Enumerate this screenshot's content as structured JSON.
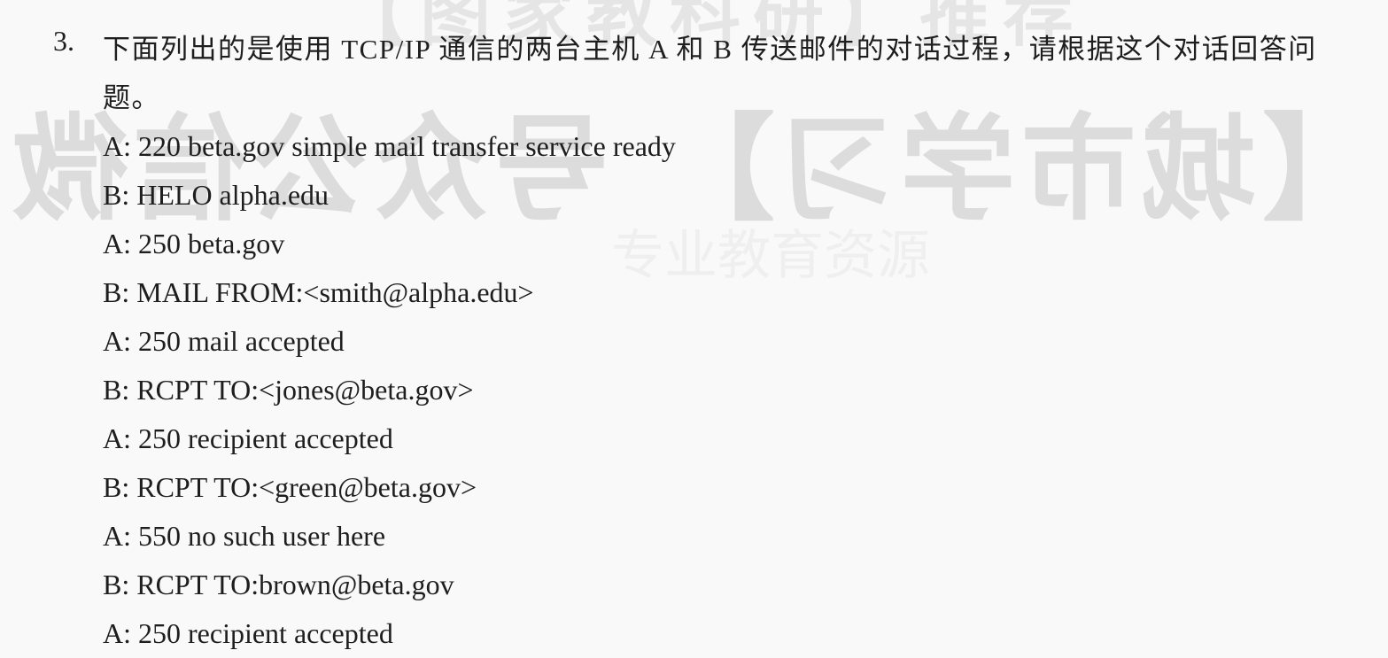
{
  "watermark": {
    "top_text": "【图家教科研】推荐",
    "main_text": "【城市学习】 号众公信微",
    "small_text": "专业教育资源"
  },
  "question": {
    "number": "3.",
    "text": "下面列出的是使用 TCP/IP 通信的两台主机 A 和 B 传送邮件的对话过程，请根据这个对话回答问题。"
  },
  "dialogue": [
    "A: 220 beta.gov simple mail transfer service ready",
    "B: HELO alpha.edu",
    "A: 250 beta.gov",
    "B: MAIL FROM:<smith@alpha.edu>",
    "A: 250 mail accepted",
    "B: RCPT TO:<jones@beta.gov>",
    "A: 250 recipient accepted",
    "B: RCPT TO:<green@beta.gov>",
    "A: 550 no such user here",
    "B: RCPT TO:brown@beta.gov",
    "A: 250 recipient accepted"
  ]
}
